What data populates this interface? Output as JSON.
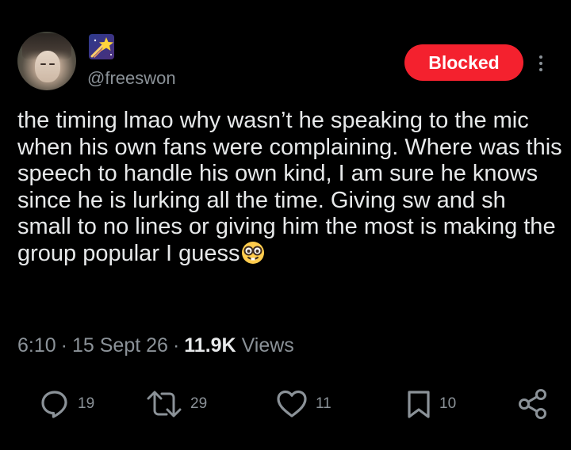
{
  "author": {
    "handle": "@freeswon",
    "name_emoji": "shooting-star-emoji"
  },
  "header": {
    "blocked_label": "Blocked",
    "more_icon": "more-vertical-icon"
  },
  "tweet": {
    "text": "the timing lmao why wasn’t he speaking to the mic when his own fans were complaining. Where was this speech to handle his own kind, I am sure he knows since he is lurking all the time. Giving sw and sh small to no lines or giving him the most is making the group popular I guess",
    "trailing_emoji": "nerd-face-emoji"
  },
  "meta": {
    "time": "6:10",
    "date": "15 Sept 26",
    "views_count": "11.9K",
    "views_label": "Views"
  },
  "actions": {
    "replies": "19",
    "reposts": "29",
    "likes": "11",
    "bookmarks": "10"
  },
  "colors": {
    "background": "#000000",
    "text": "#e7e9ea",
    "muted": "#8b9298",
    "blocked": "#f4212e"
  }
}
